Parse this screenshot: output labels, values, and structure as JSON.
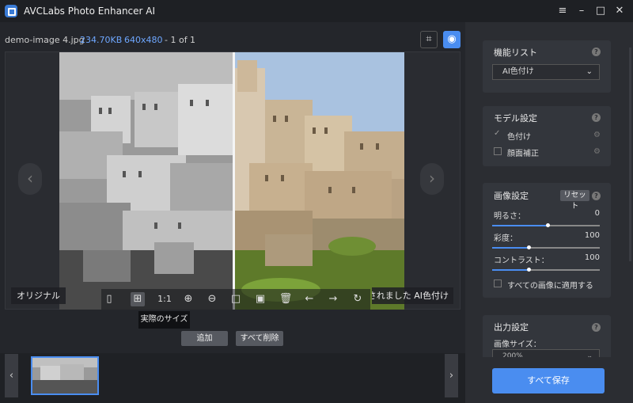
{
  "window": {
    "title": "AVCLabs Photo Enhancer AI",
    "controls": [
      "≡",
      "–",
      "□",
      "✕"
    ]
  },
  "file": {
    "name": "demo-image 4.jpg",
    "size": "234.70KB",
    "dimensions": "640x480",
    "counter": "- 1 of 1"
  },
  "preview": {
    "left_label": "オリジナル",
    "right_label": "されました AI色付け",
    "tooltip": "実際のサイズ",
    "ratio_label": "1:1"
  },
  "actions": {
    "add_label": "追加",
    "delete_all_label": "すべて削除"
  },
  "panel": {
    "function_list": {
      "title": "機能リスト",
      "selected": "AI色付け"
    },
    "model_settings": {
      "title": "モデル設定",
      "items": [
        {
          "label": "色付け",
          "checked": true
        },
        {
          "label": "顔面補正",
          "checked": false
        }
      ]
    },
    "image_settings": {
      "title": "画像設定",
      "reset_label": "リセット",
      "brightness": {
        "label": "明るさ：",
        "value": "0",
        "level": 0.5
      },
      "saturation": {
        "label": "彩度：",
        "value": "100",
        "level": 0.33
      },
      "contrast": {
        "label": "コントラスト：",
        "value": "100",
        "level": 0.33
      },
      "apply_all_label": "すべての画像に適用する"
    },
    "output_settings": {
      "title": "出力設定",
      "image_size_label": "画像サイズ：",
      "image_size_value": "200%"
    },
    "save_all_label": "すべて保存"
  },
  "colors": {
    "accent": "#4a8df0",
    "background": "#24262b",
    "panel": "#2b2d32",
    "card": "#33363c"
  }
}
